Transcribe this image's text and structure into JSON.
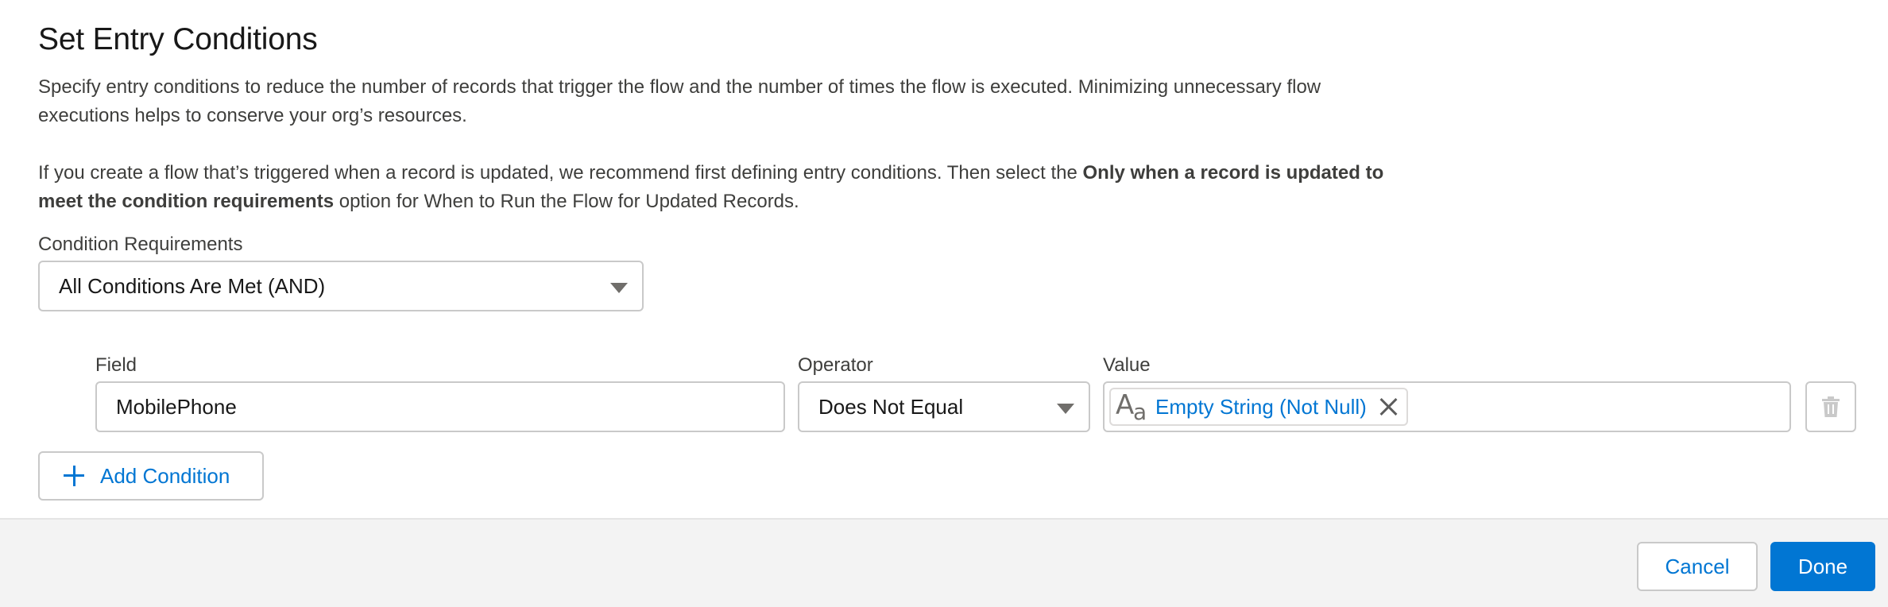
{
  "dialog": {
    "title": "Set Entry Conditions",
    "description_1": "Specify entry conditions to reduce the number of records that trigger the flow and the number of times the flow is executed. Minimizing unnecessary flow executions helps to conserve your org’s resources.",
    "description_2_before": "If you create a flow that’s triggered when a record is updated, we recommend first defining entry conditions. Then select the ",
    "description_2_bold": "Only when a record is updated to meet the condition requirements",
    "description_2_after": " option for When to Run the Flow for Updated Records."
  },
  "condition_requirements": {
    "label": "Condition Requirements",
    "selected": "All Conditions Are Met (AND)"
  },
  "condition_row": {
    "field_label": "Field",
    "field_value": "MobilePhone",
    "operator_label": "Operator",
    "operator_value": "Does Not Equal",
    "value_label": "Value",
    "value_pill": "Empty String (Not Null)",
    "value_icon": "text-type-icon"
  },
  "add_condition_label": "Add Condition",
  "footer": {
    "cancel_label": "Cancel",
    "done_label": "Done"
  },
  "colors": {
    "brand": "#0176d3",
    "border": "#c9c9c9",
    "footer_bg": "#f3f3f3"
  }
}
